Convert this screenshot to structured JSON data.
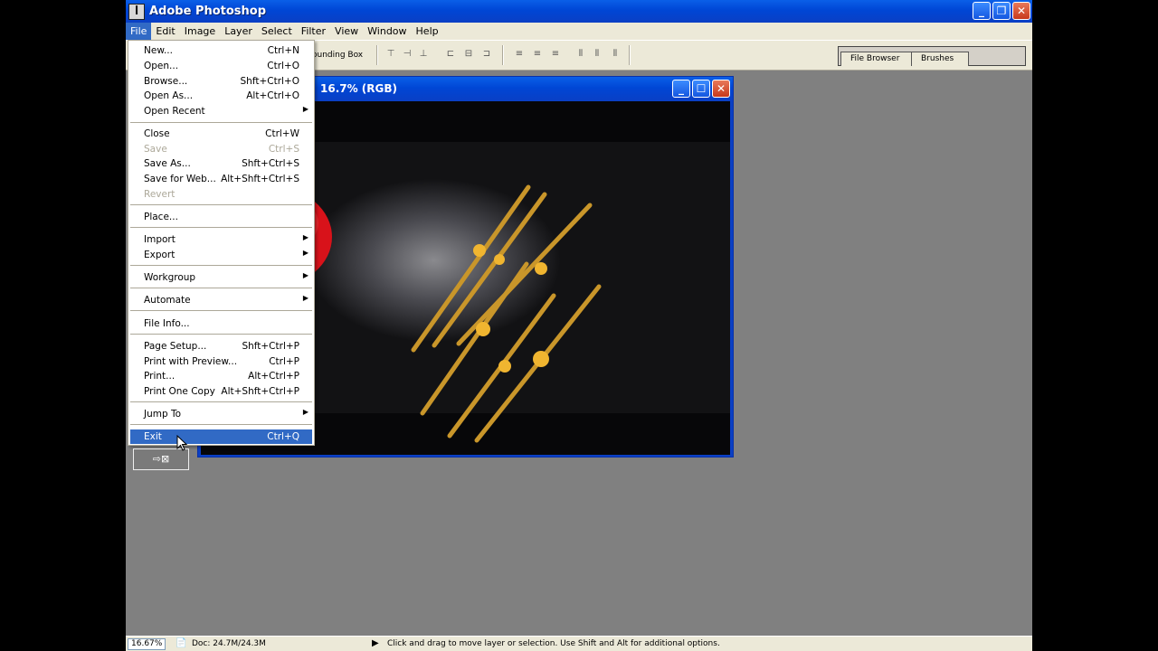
{
  "app": {
    "title": "Adobe Photoshop",
    "icon": "photoshop-icon"
  },
  "menubar": [
    "File",
    "Edit",
    "Image",
    "Layer",
    "Select",
    "Filter",
    "View",
    "Window",
    "Help"
  ],
  "options_bar": {
    "bounding_box_label": "ounding Box",
    "palette_well_tabs": [
      "File Browser",
      "Brushes"
    ]
  },
  "document": {
    "title": "16.7% (RGB)"
  },
  "file_menu": {
    "items": [
      {
        "label": "New...",
        "shortcut": "Ctrl+N"
      },
      {
        "label": "Open...",
        "shortcut": "Ctrl+O"
      },
      {
        "label": "Browse...",
        "shortcut": "Shft+Ctrl+O"
      },
      {
        "label": "Open As...",
        "shortcut": "Alt+Ctrl+O"
      },
      {
        "label": "Open Recent",
        "shortcut": ""
      },
      {
        "label": "Close",
        "shortcut": "Ctrl+W"
      },
      {
        "label": "Save",
        "shortcut": "Ctrl+S"
      },
      {
        "label": "Save As...",
        "shortcut": "Shft+Ctrl+S"
      },
      {
        "label": "Save for Web...",
        "shortcut": "Alt+Shft+Ctrl+S"
      },
      {
        "label": "Revert",
        "shortcut": ""
      },
      {
        "label": "Place...",
        "shortcut": ""
      },
      {
        "label": "Import",
        "shortcut": ""
      },
      {
        "label": "Export",
        "shortcut": ""
      },
      {
        "label": "Workgroup",
        "shortcut": ""
      },
      {
        "label": "Automate",
        "shortcut": ""
      },
      {
        "label": "File Info...",
        "shortcut": ""
      },
      {
        "label": "Page Setup...",
        "shortcut": "Shft+Ctrl+P"
      },
      {
        "label": "Print with Preview...",
        "shortcut": "Ctrl+P"
      },
      {
        "label": "Print...",
        "shortcut": "Alt+Ctrl+P"
      },
      {
        "label": "Print One Copy",
        "shortcut": "Alt+Shft+Ctrl+P"
      },
      {
        "label": "Jump To",
        "shortcut": ""
      },
      {
        "label": "Exit",
        "shortcut": "Ctrl+Q"
      }
    ]
  },
  "status_bar": {
    "zoom": "16.67%",
    "doc_size": "Doc: 24.7M/24.3M",
    "hint": "Click and drag to move layer or selection.  Use Shift and Alt for additional options."
  },
  "colors": {
    "selection": "#316ac5",
    "titlebar": "#0046d5",
    "workspace": "#808080"
  }
}
